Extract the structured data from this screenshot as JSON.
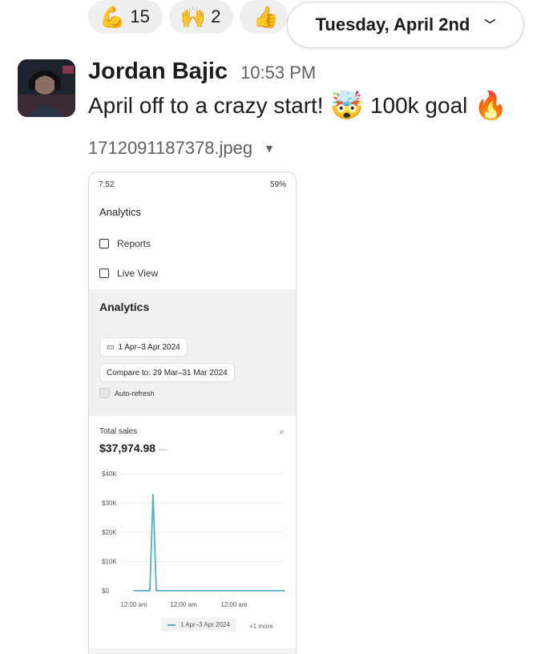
{
  "reactions": [
    {
      "emoji": "💪",
      "count": "15"
    },
    {
      "emoji": "🙌",
      "count": "2"
    },
    {
      "emoji": "👍",
      "count": ""
    }
  ],
  "date_divider": {
    "label": "Tuesday, April 2nd",
    "icon": "chevron-down-icon"
  },
  "message": {
    "author": "Jordan Bajic",
    "time": "10:53 PM",
    "text_part1": "April off to a crazy start!",
    "emoji1": "🤯",
    "text_part2": "100k goal",
    "emoji2": "🔥"
  },
  "attachment": {
    "file_name": "1712091187378.jpeg",
    "screenshot": {
      "status": {
        "time": "7:52",
        "battery": "59%"
      },
      "header_title": "Analytics",
      "nav": [
        {
          "label": "Reports",
          "icon": "reports-icon"
        },
        {
          "label": "Live View",
          "icon": "live-view-icon"
        }
      ],
      "section_title": "Analytics",
      "date_range": "1 Apr–3 Apr 2024",
      "compare": "Compare to: 29 Mar–31 Mar 2024",
      "auto_refresh": "Auto-refresh",
      "total_sales_label": "Total sales",
      "total_sales_value": "$37,974.98",
      "total_sales_dash": "—",
      "legend_label": "1 Apr–3 Apr 2024",
      "more_label": "+1 more",
      "accent": "#4fb0c8"
    }
  },
  "chart_data": {
    "type": "line",
    "y_ticks": [
      "$40K",
      "$30K",
      "$20K",
      "$10K",
      "$0"
    ],
    "x_ticks": [
      "12:00 am",
      "12:00 am",
      "12:00 am"
    ],
    "ylim": [
      0,
      40000
    ],
    "series": [
      {
        "name": "1 Apr–3 Apr 2024",
        "values": [
          0,
          0,
          33000,
          0,
          0,
          0
        ]
      }
    ]
  }
}
